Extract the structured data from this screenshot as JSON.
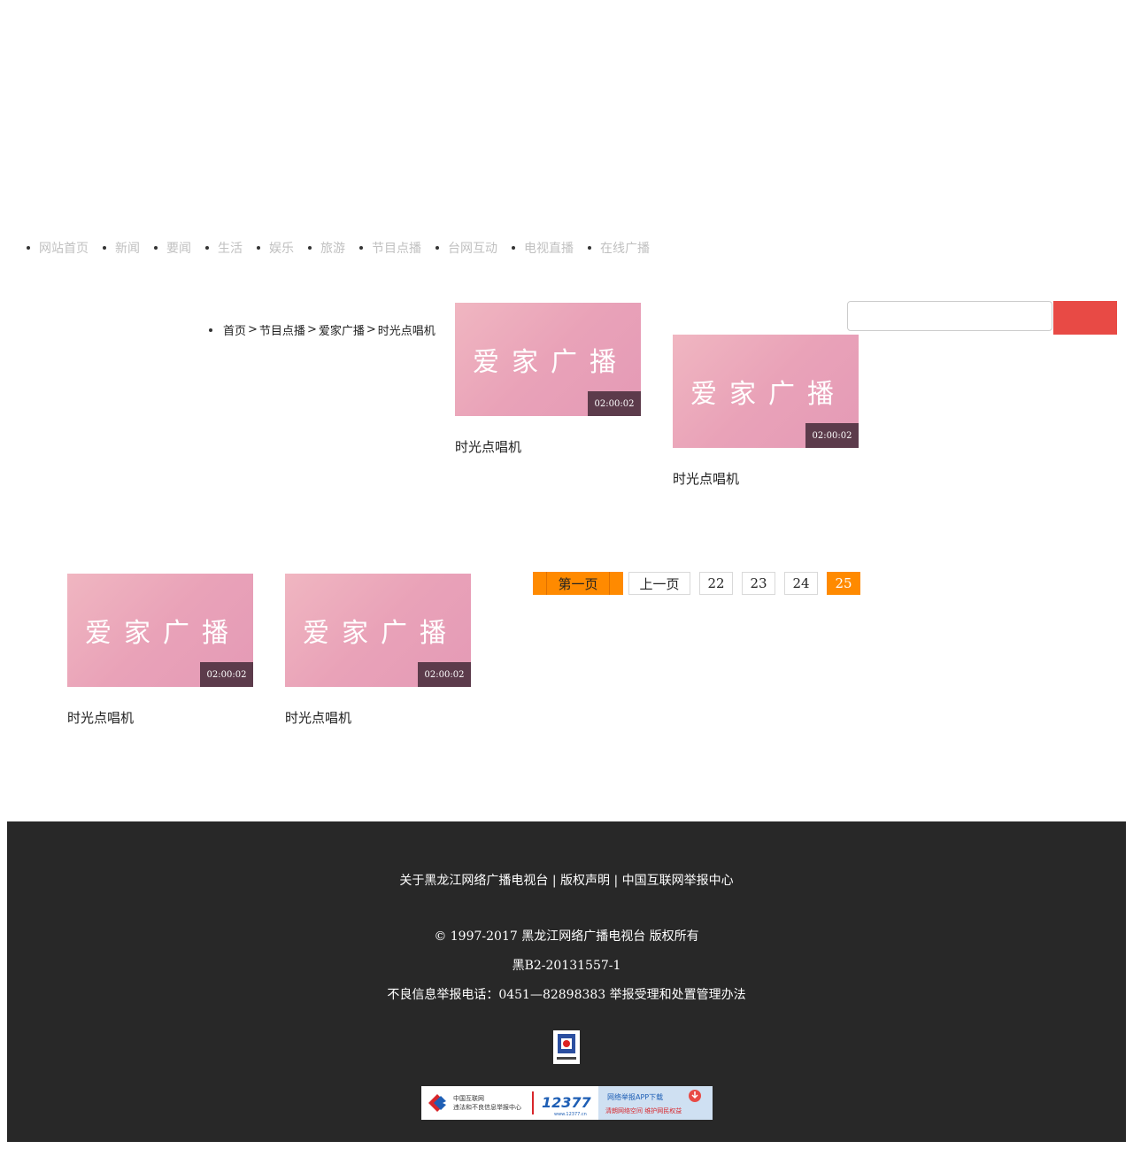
{
  "nav": {
    "items": [
      "网站首页",
      "新闻",
      "要闻",
      "生活",
      "娱乐",
      "旅游",
      "节目点播",
      "台网互动",
      "电视直播",
      "在线广播"
    ]
  },
  "breadcrumb": {
    "items": [
      "首页",
      "节目点播",
      "爱家广播",
      "时光点唱机"
    ],
    "separator": ">"
  },
  "search": {
    "placeholder": "",
    "button_label": ""
  },
  "cards": [
    {
      "thumb_text": "爱家广播",
      "duration": "02:00:02",
      "title": "时光点唱机"
    },
    {
      "thumb_text": "爱家广播",
      "duration": "02:00:02",
      "title": "时光点唱机"
    },
    {
      "thumb_text": "爱家广播",
      "duration": "02:00:02",
      "title": "时光点唱机"
    },
    {
      "thumb_text": "爱家广播",
      "duration": "02:00:02",
      "title": "时光点唱机"
    }
  ],
  "pagination": {
    "first": "第一页",
    "prev": "上一页",
    "pages": [
      "22",
      "23",
      "24"
    ],
    "current": "25"
  },
  "footer": {
    "links_line": "关于黑龙江网络广播电视台 | 版权声明 | 中国互联网举报中心",
    "copyright": "© 1997-2017 黑龙江网络广播电视台 版权所有",
    "license": "黑B2-20131557-1",
    "report_line": "不良信息举报电话：0451—82898383 举报受理和处置管理办法",
    "banner": {
      "left_title": "中国互联网",
      "left_subtitle": "违法和不良信息举报中心",
      "hotline": "12377",
      "hotline_url": "www.12377.cn",
      "right_title": "网络举报APP下载",
      "right_slogan": "清朗网络空间 维护网民权益"
    }
  },
  "colors": {
    "accent_orange": "#ff8a00",
    "search_button": "#e84a45",
    "footer_bg": "#282828",
    "duration_bg": "#5c3b4b"
  }
}
